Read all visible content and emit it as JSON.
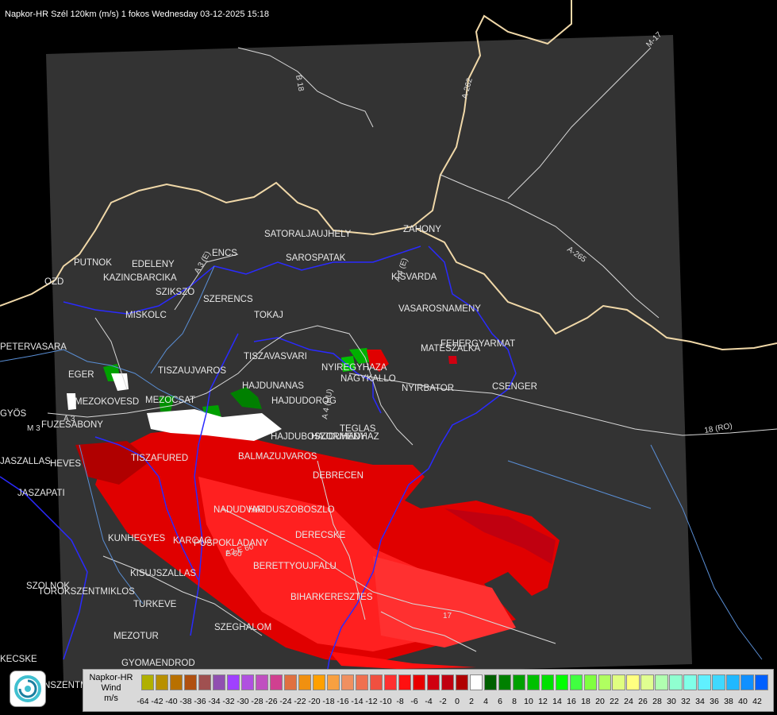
{
  "title": "Napkor-HR Szél 120km (m/s) 1 fokos Wednesday 03-12-2025 15:18",
  "cities": [
    {
      "name": "SATORALJAUJHELY"
    },
    {
      "name": "SAROSPATAK"
    },
    {
      "name": "ZAHONY"
    },
    {
      "name": "KISVARDA"
    },
    {
      "name": "VASAROSNAMENY"
    },
    {
      "name": "FEHERGYARMAT"
    },
    {
      "name": "MATESZALKA"
    },
    {
      "name": "PUTNOK"
    },
    {
      "name": "EDELENY"
    },
    {
      "name": "KAZINCBARCIKA"
    },
    {
      "name": "ENCS"
    },
    {
      "name": "SZIKSZO"
    },
    {
      "name": "SZERENCS"
    },
    {
      "name": "MISKOLC"
    },
    {
      "name": "TOKAJ"
    },
    {
      "name": "OZD"
    },
    {
      "name": "PETERVASARA"
    },
    {
      "name": "EGER"
    },
    {
      "name": "TISZAUJVAROS"
    },
    {
      "name": "TISZAVASVARI"
    },
    {
      "name": "NYIREGYHAZA"
    },
    {
      "name": "NAGYKALLO"
    },
    {
      "name": "NYIRBATOR"
    },
    {
      "name": "CSENGER"
    },
    {
      "name": "HAJDUNANAS"
    },
    {
      "name": "HAJDUDOROG"
    },
    {
      "name": "MEZOKOVESD"
    },
    {
      "name": "MEZOCSAT"
    },
    {
      "name": "GYÖS"
    },
    {
      "name": "FUZESABONY"
    },
    {
      "name": "TEGLAS"
    },
    {
      "name": "HAJDUBOSZORMENY"
    },
    {
      "name": "HAJDUHADHAZ"
    },
    {
      "name": "TISZAFURED"
    },
    {
      "name": "BALMAZUJVAROS"
    },
    {
      "name": "HEVES"
    },
    {
      "name": "DEBRECEN"
    },
    {
      "name": "JASZAPATI"
    },
    {
      "name": "JASZALLAS"
    },
    {
      "name": "NADUDVAR"
    },
    {
      "name": "HAJDUSZOBOSZLO"
    },
    {
      "name": "KUNHEGYES"
    },
    {
      "name": "DERECSKE"
    },
    {
      "name": "KARCAG"
    },
    {
      "name": "PUSPOKLADANY"
    },
    {
      "name": "BERETTYOUJFALU"
    },
    {
      "name": "KISUJSZALLAS"
    },
    {
      "name": "SZOLNOK"
    },
    {
      "name": "TOROKSZENTMIKLOS"
    },
    {
      "name": "BIHARKERESZTES"
    },
    {
      "name": "TURKEVE"
    },
    {
      "name": "SZEGHALOM"
    },
    {
      "name": "MEZOTUR"
    },
    {
      "name": "KECSKE"
    },
    {
      "name": "GYOMAENDROD"
    },
    {
      "name": "NSZENTMI"
    }
  ],
  "roads": [
    "B 18",
    "A-262",
    "M-17",
    "A-265",
    "18 (RO)",
    "A 3 (E)",
    "A 4 (E)",
    "M 3",
    "A 3",
    "A 4 (HU)",
    "E 60",
    "A2-E 60",
    "17"
  ],
  "legend": {
    "name_line1": "Napkor-HR",
    "name_line2": "Wind",
    "unit": "m/s",
    "colors": [
      "#b0b000",
      "#b89000",
      "#b87000",
      "#b05010",
      "#a05050",
      "#9050b0",
      "#a040ff",
      "#b050e0",
      "#c050c0",
      "#d04090",
      "#e07040",
      "#f09010",
      "#ffa000",
      "#f8a040",
      "#f09060",
      "#f07050",
      "#f05040",
      "#ff3030",
      "#ff1010",
      "#e80000",
      "#d00010",
      "#c00010",
      "#b00000",
      "#ffffff",
      "#006000",
      "#008000",
      "#00a000",
      "#00c000",
      "#00e000",
      "#00ff00",
      "#40ff40",
      "#80ff40",
      "#b0ff60",
      "#e0ff80",
      "#ffff80",
      "#e0ff90",
      "#b0ffb0",
      "#90ffd0",
      "#80ffe8",
      "#60f0ff",
      "#40d8ff",
      "#20b8ff",
      "#1090ff",
      "#0060ff",
      "#0030ff",
      "#0000ff"
    ],
    "ticks": [
      "-64",
      "-42",
      "-40",
      "-38",
      "-36",
      "-34",
      "-32",
      "-30",
      "-28",
      "-26",
      "-24",
      "-22",
      "-20",
      "-18",
      "-16",
      "-14",
      "-12",
      "-10",
      "-8",
      "-6",
      "-4",
      "-2",
      "0",
      "2",
      "4",
      "6",
      "8",
      "10",
      "12",
      "14",
      "16",
      "18",
      "20",
      "22",
      "24",
      "26",
      "28",
      "30",
      "32",
      "34",
      "36",
      "38",
      "40",
      "42"
    ]
  }
}
